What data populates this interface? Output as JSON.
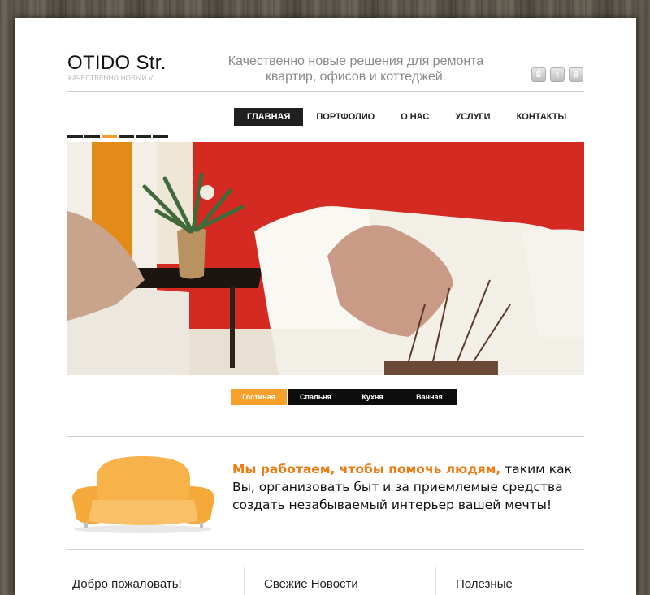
{
  "brand": {
    "title": "OTIDO Str.",
    "subtitle": "КАЧЕСТВЕННО НОВЫЙ V"
  },
  "tagline": "Качественно новые решения для ремонта квартир, офисов и коттеджей.",
  "social": [
    {
      "icon": "skype-icon",
      "glyph": "S"
    },
    {
      "icon": "twitter-icon",
      "glyph": "t"
    },
    {
      "icon": "vkontakte-icon",
      "glyph": "В"
    }
  ],
  "nav": {
    "items": [
      {
        "label": "ГЛАВНАЯ",
        "active": true
      },
      {
        "label": "ПОРТФОЛИО",
        "active": false
      },
      {
        "label": "О НАС",
        "active": false
      },
      {
        "label": "УСЛУГИ",
        "active": false
      },
      {
        "label": "КОНТАКТЫ",
        "active": false
      }
    ]
  },
  "slider": {
    "active_index": 2,
    "count": 6
  },
  "tabs": [
    {
      "label": "Гостиная",
      "active": true
    },
    {
      "label": "Спальня",
      "active": false
    },
    {
      "label": "Кухня",
      "active": false
    },
    {
      "label": "Ванная",
      "active": false
    }
  ],
  "mission": {
    "highlight": "Мы работаем, чтобы помочь людям,",
    "rest": " таким как Вы, организовать быт и за приемлемые средства создать незабываемый интерьер вашей мечты!"
  },
  "columns": {
    "welcome": "Добро пожаловать!",
    "news": "Свежие Новости",
    "useful": "Полезные"
  },
  "colors": {
    "accent": "#f39c2d",
    "nav_active": "#1f1f1f",
    "hero_wall": "#d8231f"
  }
}
